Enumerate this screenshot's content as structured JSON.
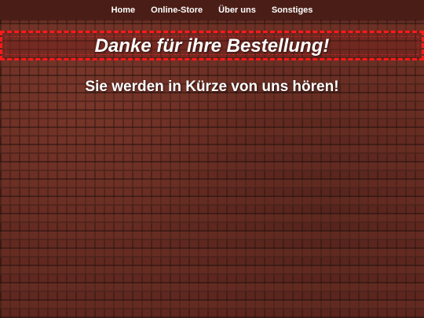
{
  "nav": {
    "items": [
      "Home",
      "Online-Store",
      "Über uns",
      "Sonstiges"
    ]
  },
  "banner": {
    "title": "Danke für ihre Bestellung!"
  },
  "main": {
    "subtitle": "Sie werden in Kürze von uns hören!"
  },
  "colors": {
    "nav_background": "#4a1e16",
    "banner_border": "#ff1a1a",
    "text": "#ffffff",
    "background_brick": "#6b2f24"
  }
}
